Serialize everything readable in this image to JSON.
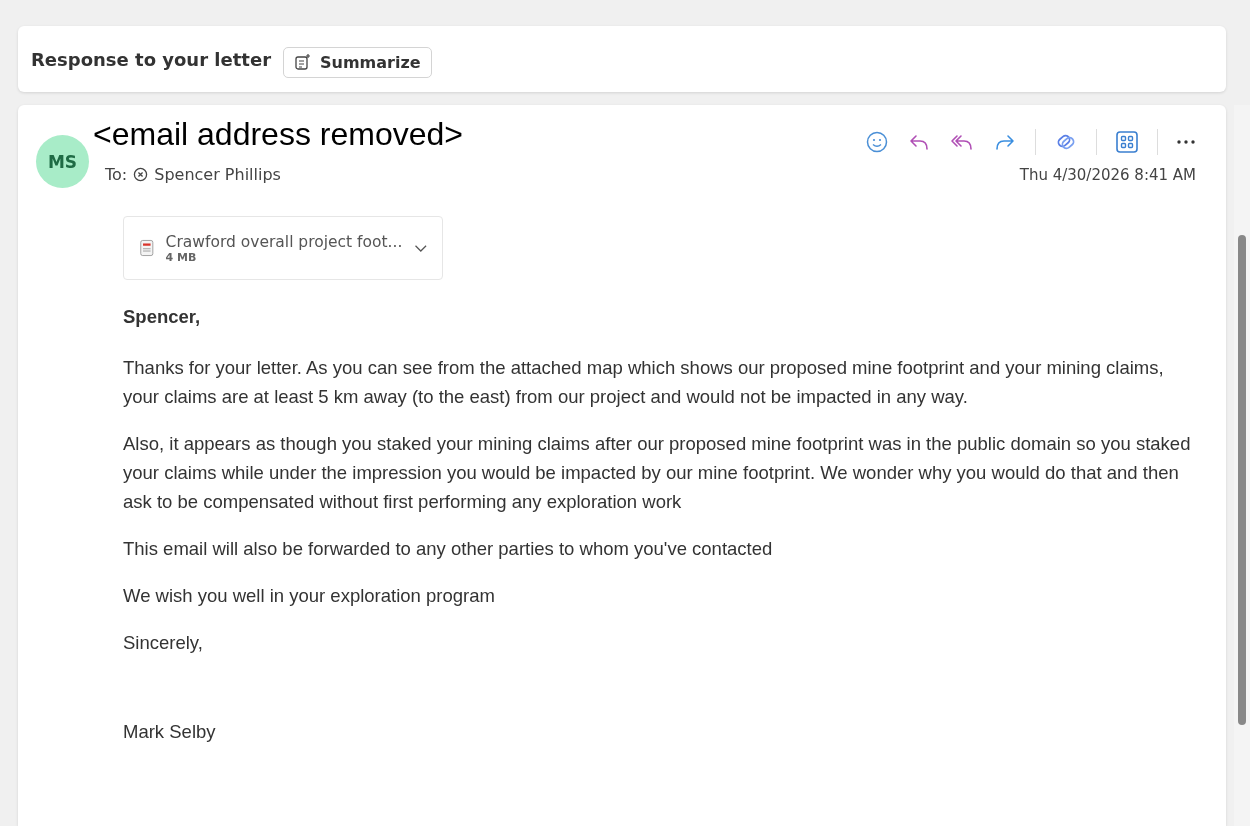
{
  "subject": {
    "title": "Response to your letter",
    "summarize_button": "Summarize"
  },
  "message": {
    "avatar_initials": "MS",
    "sender": "<email address removed>",
    "to_label": "To:",
    "recipient": "Spencer Phillips",
    "date": "Thu 4/30/2026 8:41 AM",
    "attachment": {
      "name": "Crawford overall project foot...",
      "size": "4 MB"
    },
    "body": [
      "Spencer,",
      "Thanks for your letter. As you can see from the attached map which shows our proposed mine footprint and your mining claims, your claims are at least 5 km away (to the east) from our project and would not be impacted in any way.",
      "Also, it appears as though you staked your mining claims after our proposed mine footprint was in the public domain so you staked your claims while under the impression you would be impacted by our mine footprint. We wonder why you would do that and then ask to be compensated without first performing any exploration work",
      "This email will also be forwarded to any other parties to whom you've contacted",
      "We wish you well in your exploration program",
      "Sincerely,",
      "Mark Selby"
    ]
  }
}
